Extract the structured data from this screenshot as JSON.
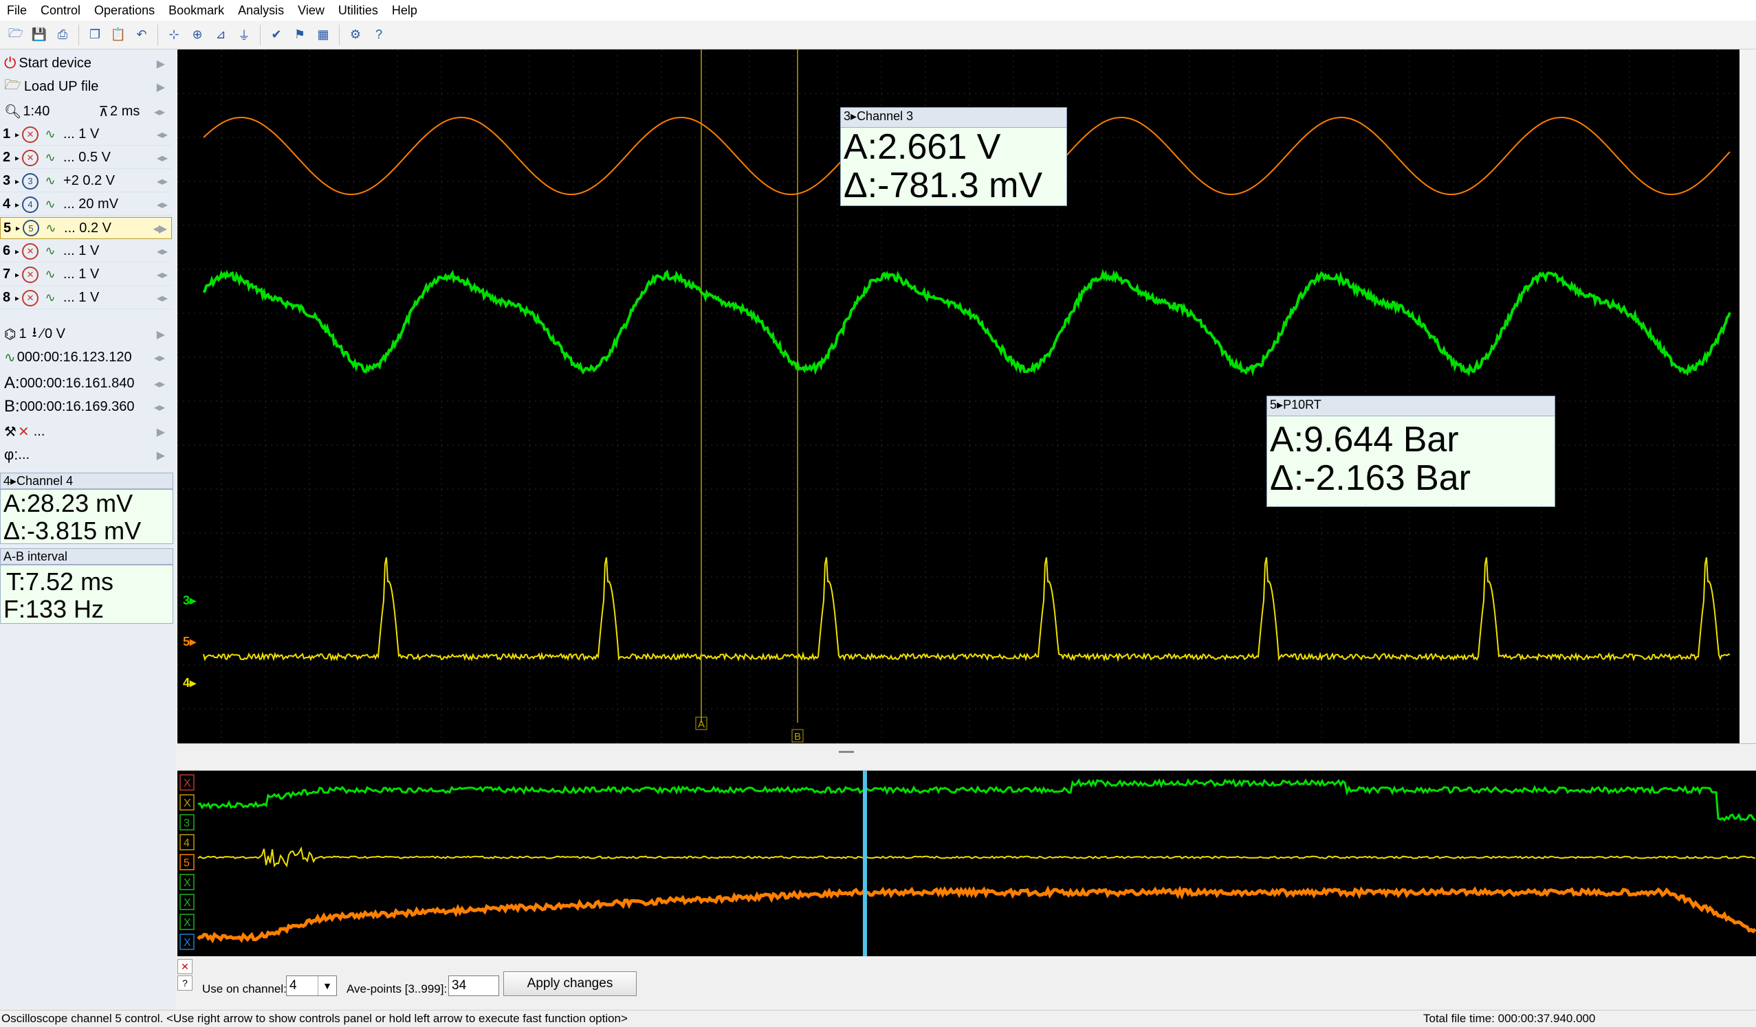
{
  "menu": [
    "File",
    "Control",
    "Operations",
    "Bookmark",
    "Analysis",
    "View",
    "Utilities",
    "Help"
  ],
  "toolbar_icons": [
    "open-icon",
    "save-icon",
    "print-icon",
    "copy-icon",
    "paste-icon",
    "undo-icon",
    "cursor-icon",
    "zoom-icon",
    "measure-icon",
    "filter-icon",
    "check-icon",
    "bookmark-icon",
    "grid-icon",
    "auto-icon",
    "help-icon"
  ],
  "left_panel": {
    "start_device": "Start device",
    "load_up_file": "Load UP file",
    "zoom": "1:40",
    "timebase": "2 ms",
    "channels": [
      {
        "num": "1",
        "icon": "off",
        "val": "... 1 V"
      },
      {
        "num": "2",
        "icon": "off",
        "val": "... 0.5 V"
      },
      {
        "num": "3",
        "icon": "3",
        "val": "+2 0.2 V"
      },
      {
        "num": "4",
        "icon": "4",
        "val": "... 20 mV"
      },
      {
        "num": "5",
        "icon": "5",
        "val": "... 0.2 V"
      },
      {
        "num": "6",
        "icon": "off",
        "val": "... 1 V"
      },
      {
        "num": "7",
        "icon": "off",
        "val": "... 1 V"
      },
      {
        "num": "8",
        "icon": "off",
        "val": "... 1 V"
      }
    ],
    "trigger": "1",
    "trigger_level": "0 V",
    "trigger_time": "000:00:16.123.120",
    "cursor_a_label": "A:",
    "cursor_a": "000:00:16.161.840",
    "cursor_b_label": "B:",
    "cursor_b": "000:00:16.169.360",
    "phase_label": "φ:",
    "dots": "...",
    "ch4_box": {
      "title": "Channel 4",
      "a": "A:28.23 mV",
      "d": "Δ:-3.815 mV"
    },
    "ab_box": {
      "title": "A-B interval",
      "t": "T:7.52 ms",
      "f": "F:133 Hz"
    }
  },
  "scope": {
    "tip_ch3": {
      "title": "Channel 3",
      "a": "A:2.661 V",
      "d": "Δ:-781.3 mV"
    },
    "tip_p10rt": {
      "title": "P10RT",
      "a": "A:9.644 Bar",
      "d": "Δ:-2.163 Bar"
    },
    "tip_ch3_num": "3",
    "tip_p10rt_num": "5",
    "marker_a": "A",
    "marker_b": "B",
    "ch_markers": [
      "3",
      "5",
      "4"
    ],
    "colors": {
      "orange": "#ff7f00",
      "green": "#00e000",
      "yellow": "#f0e000",
      "grid": "#2a2a2a",
      "cursor": "#b8a000"
    }
  },
  "overview_labels": [
    "X",
    "X",
    "3",
    "4",
    "5",
    "X",
    "X",
    "X",
    "X"
  ],
  "controls": {
    "use_on_channel_label": "Use on channel:",
    "use_on_channel_value": "4",
    "ave_points_label": "Ave-points [3..999]:",
    "ave_points_value": "34",
    "apply_label": "Apply changes"
  },
  "status": {
    "left": "Oscilloscope channel 5 control. <Use right arrow to show controls panel or hold left arrow to execute fast function option>",
    "right": "Total file time: 000:00:37.940.000"
  }
}
